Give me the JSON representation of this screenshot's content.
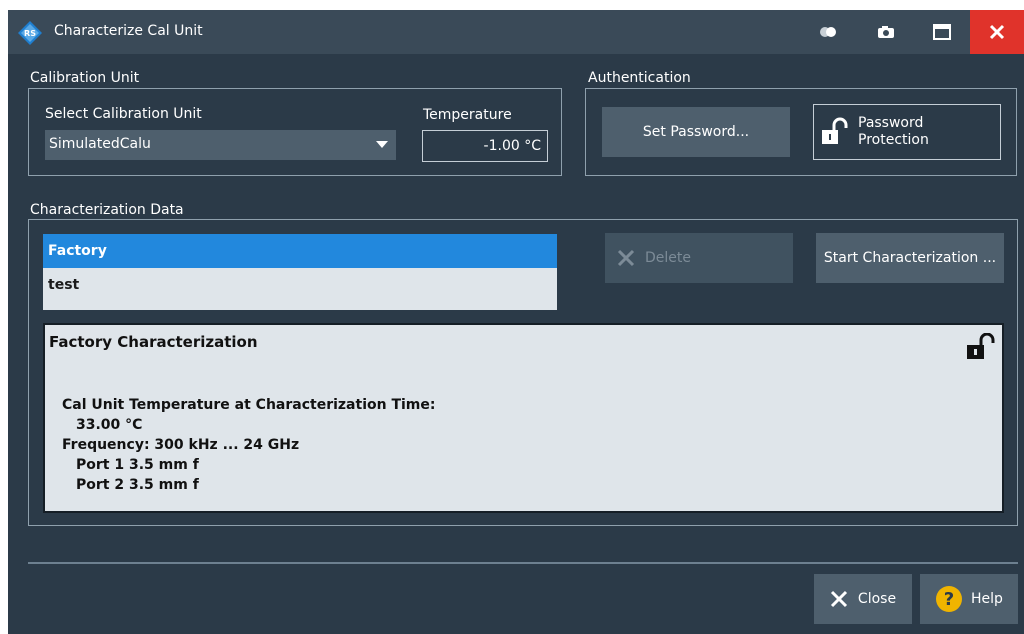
{
  "window": {
    "title": "Characterize Cal Unit",
    "icons": [
      "rs-logo-icon",
      "toggle-icon",
      "camera-icon",
      "maximize-icon",
      "close-icon"
    ]
  },
  "calibration_unit": {
    "section_label": "Calibration Unit",
    "select_label": "Select Calibration Unit",
    "selected_value": "SimulatedCalu",
    "temperature_label": "Temperature",
    "temperature_value": "-1.00 °C"
  },
  "authentication": {
    "section_label": "Authentication",
    "set_password_label": "Set Password...",
    "password_protection_line1": "Password",
    "password_protection_line2": "Protection"
  },
  "characterization": {
    "section_label": "Characterization Data",
    "items": [
      {
        "label": "Factory",
        "selected": true
      },
      {
        "label": "test",
        "selected": false
      }
    ],
    "delete_label": "Delete",
    "start_label": "Start Characterization ...",
    "info": {
      "title": "Factory Characterization",
      "lines": [
        "Cal Unit Temperature at Characterization Time:",
        "33.00 °C",
        "Frequency: 300 kHz ... 24 GHz",
        "Port 1 3.5 mm f",
        "Port 2 3.5 mm f"
      ]
    }
  },
  "footer": {
    "close_label": "Close",
    "help_label": "Help"
  },
  "colors": {
    "background": "#2b3a48",
    "titlebar": "#3a4a58",
    "button": "#4e5f6d",
    "selection": "#2288dd",
    "close": "#e0332b",
    "help": "#f0b400"
  }
}
